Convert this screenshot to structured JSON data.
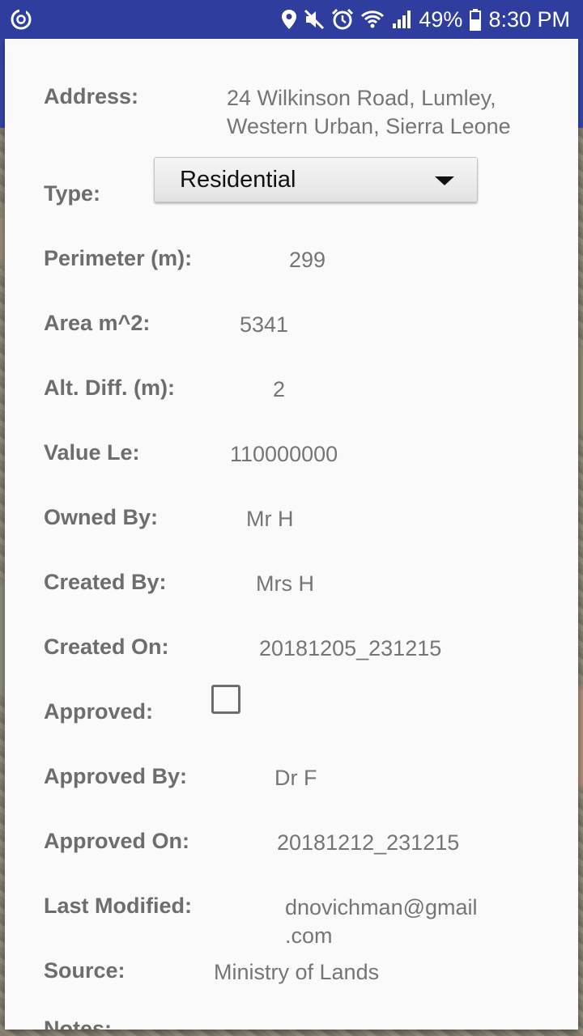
{
  "status_bar": {
    "battery": "49%",
    "time": "8:30 PM",
    "icons": [
      "app-sync-icon",
      "location-icon",
      "mute-icon",
      "alarm-icon",
      "wifi-icon",
      "signal-icon",
      "battery-icon"
    ]
  },
  "form": {
    "address": {
      "label": "Address:",
      "value_line1": "24 Wilkinson Road, Lumley,",
      "value_line2": "Western Urban, Sierra Leone"
    },
    "type": {
      "label": "Type:",
      "selected": "Residential"
    },
    "perimeter": {
      "label": "Perimeter (m):",
      "value": "299"
    },
    "area": {
      "label": "Area m^2:",
      "value": "5341"
    },
    "alt_diff": {
      "label": "Alt. Diff. (m):",
      "value": "2"
    },
    "value_le": {
      "label": "Value Le:",
      "value": "110000000"
    },
    "owned_by": {
      "label": "Owned By:",
      "value": "Mr H"
    },
    "created_by": {
      "label": "Created By:",
      "value": "Mrs H"
    },
    "created_on": {
      "label": "Created On:",
      "value": "20181205_231215"
    },
    "approved": {
      "label": "Approved:",
      "checked": false
    },
    "approved_by": {
      "label": "Approved By:",
      "value": "Dr F"
    },
    "approved_on": {
      "label": "Approved On:",
      "value": "20181212_231215"
    },
    "last_modified": {
      "label": "Last Modified:",
      "value_line1": "dnovichman@gmail",
      "value_line2": ".com"
    },
    "source": {
      "label": "Source:",
      "value": "Ministry of Lands"
    },
    "notes": {
      "label": "Notes:"
    }
  }
}
